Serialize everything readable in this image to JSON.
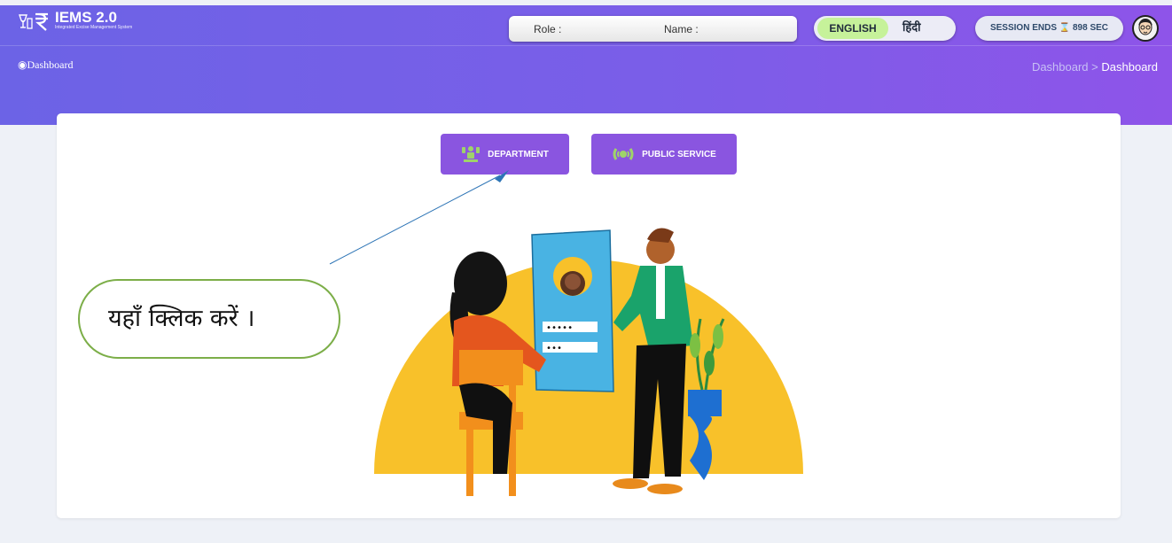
{
  "header": {
    "app_title": "IEMS 2.0",
    "app_subtitle": "Integrated Excise Management System",
    "role_label": "Role :",
    "name_label": "Name :",
    "lang_english": "ENGLISH",
    "lang_hindi": "हिंदी",
    "session": "SESSION ENDS ⌛ 898 SEC"
  },
  "breadcrumb": {
    "page_title": "Dashboard",
    "root": "Dashboard",
    "separator": ">",
    "current": "Dashboard"
  },
  "main": {
    "department_button": "DEPARTMENT",
    "public_service_button": "PUBLIC SERVICE"
  },
  "annotation": {
    "callout_text": "यहाँ क्लिक करें ।"
  },
  "colors": {
    "header_gradient_start": "#6c63e6",
    "header_gradient_end": "#8e54e9",
    "button": "#8a55e0",
    "english_toggle": "#c6f29a",
    "callout_border": "#7cae48"
  }
}
